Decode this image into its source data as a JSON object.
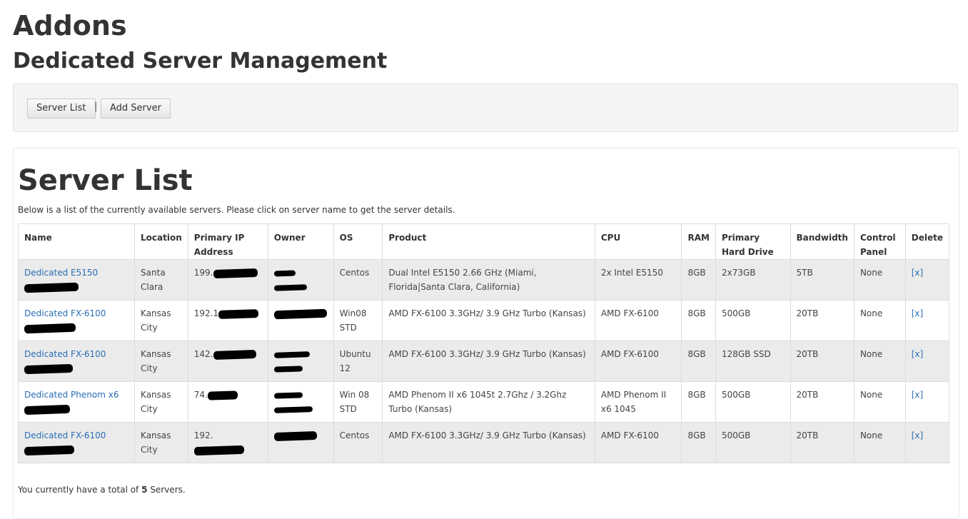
{
  "header": {
    "title": "Addons",
    "subtitle": "Dedicated Server Management"
  },
  "toolbar": {
    "server_list_label": "Server List",
    "separator": "|",
    "add_server_label": "Add Server"
  },
  "panel": {
    "title": "Server List",
    "description": "Below is a list of the currently available servers. Please click on server name to get the server details."
  },
  "table": {
    "columns": [
      "Name",
      "Location",
      "Primary IP Address",
      "Owner",
      "OS",
      "Product",
      "CPU",
      "RAM",
      "Primary Hard Drive",
      "Bandwidth",
      "Control Panel",
      "Delete"
    ],
    "rows": [
      {
        "name": "Dedicated E5150",
        "location": "Santa Clara",
        "ip": "199.",
        "owner": "",
        "os": "Centos",
        "product": "Dual Intel E5150 2.66 GHz (Miami, Florida|Santa Clara, California)",
        "cpu": "2x Intel E5150",
        "ram": "8GB",
        "hdd": "2x73GB",
        "bandwidth": "5TB",
        "control_panel": "None",
        "delete": "[x]"
      },
      {
        "name": "Dedicated FX-6100",
        "location": "Kansas City",
        "ip": "192.1",
        "owner": "",
        "os": "Win08 STD",
        "product": "AMD FX-6100 3.3GHz/ 3.9 GHz Turbo (Kansas)",
        "cpu": "AMD FX-6100",
        "ram": "8GB",
        "hdd": "500GB",
        "bandwidth": "20TB",
        "control_panel": "None",
        "delete": "[x]"
      },
      {
        "name": "Dedicated FX-6100",
        "location": "Kansas City",
        "ip": "142.",
        "owner": "",
        "os": "Ubuntu 12",
        "product": "AMD FX-6100 3.3GHz/ 3.9 GHz Turbo (Kansas)",
        "cpu": "AMD FX-6100",
        "ram": "8GB",
        "hdd": "128GB SSD",
        "bandwidth": "20TB",
        "control_panel": "None",
        "delete": "[x]"
      },
      {
        "name": "Dedicated Phenom x6",
        "location": "Kansas City",
        "ip": "74.",
        "owner": "",
        "os": "Win 08 STD",
        "product": "AMD Phenom II x6 1045t 2.7Ghz / 3.2Ghz Turbo (Kansas)",
        "cpu": "AMD Phenom II x6 1045",
        "ram": "8GB",
        "hdd": "500GB",
        "bandwidth": "20TB",
        "control_panel": "None",
        "delete": "[x]"
      },
      {
        "name": "Dedicated FX-6100",
        "location": "Kansas City",
        "ip": "192.",
        "owner": "",
        "os": "Centos",
        "product": "AMD FX-6100 3.3GHz/ 3.9 GHz Turbo (Kansas)",
        "cpu": "AMD FX-6100",
        "ram": "8GB",
        "hdd": "500GB",
        "bandwidth": "20TB",
        "control_panel": "None",
        "delete": "[x]"
      }
    ]
  },
  "footer": {
    "prefix": "You currently have a total of",
    "count": "5",
    "suffix": "Servers."
  },
  "colors": {
    "link": "#2a6db5",
    "row_alt": "#ebebeb",
    "toolbar_bg": "#f4f4f4",
    "redaction": "#000000"
  }
}
